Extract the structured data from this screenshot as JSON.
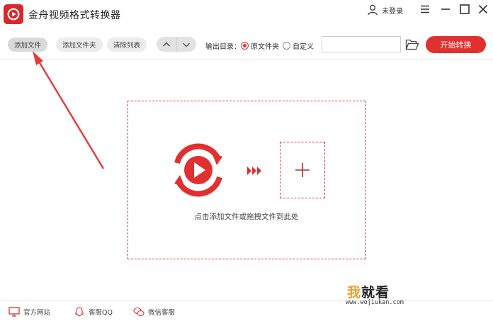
{
  "titlebar": {
    "app_title": "金舟视频格式转换器",
    "user_label": "未登录",
    "icons": [
      "app-logo",
      "user-icon",
      "menu-icon",
      "minimize-icon",
      "maximize-icon",
      "close-icon"
    ]
  },
  "toolbar": {
    "add_file": "添加文件",
    "add_folder": "添加文件夹",
    "clear_list": "清除列表",
    "output_dir_label": "输出目录：",
    "option_original": "原文件夹",
    "option_custom": "自定义",
    "selected_option": "原文件夹",
    "path_value": "",
    "start_label": "开始转换"
  },
  "dropzone": {
    "hint": "点击添加文件或拖拽文件到此处"
  },
  "footer": {
    "website": "官方网站",
    "qq": "客服QQ",
    "wechat": "微信客服"
  },
  "watermark": {
    "brand_first": "我",
    "brand_rest": "就看",
    "url": "www.wojiukan.com"
  },
  "colors": {
    "accent": "#e0302f",
    "logo_bg": "#d8282a",
    "annotation": "#e53a3a"
  }
}
